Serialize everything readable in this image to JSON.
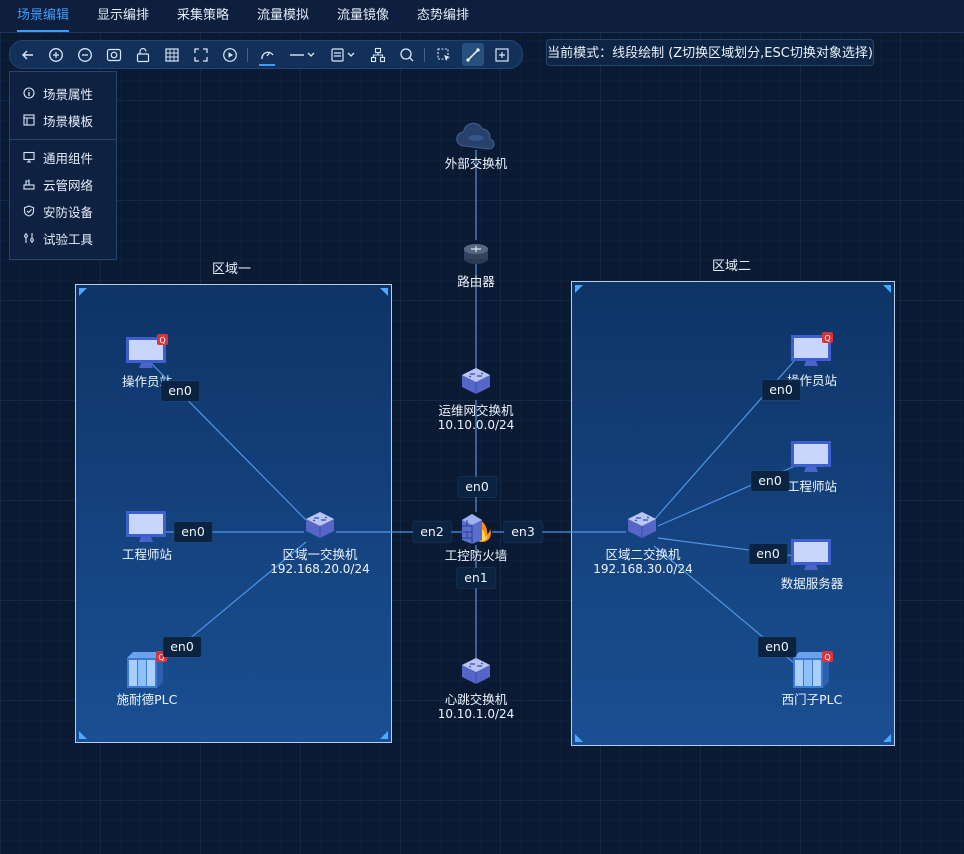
{
  "menu": {
    "items": [
      {
        "label": "场景编辑",
        "active": true
      },
      {
        "label": "显示编排",
        "active": false
      },
      {
        "label": "采集策略",
        "active": false
      },
      {
        "label": "流量模拟",
        "active": false
      },
      {
        "label": "流量镜像",
        "active": false
      },
      {
        "label": "态势编排",
        "active": false
      }
    ]
  },
  "toolbar": {
    "tools": [
      "back-icon",
      "zoom-in-icon",
      "zoom-out-icon",
      "fit-view-icon",
      "lock-icon",
      "grid-icon",
      "fullscreen-icon",
      "play-icon",
      "line-style-icon",
      "line-dash-icon",
      "layer-icon",
      "topology-icon",
      "search-icon",
      "select-region-icon",
      "line-draw-icon",
      "add-frame-icon"
    ],
    "active_tool": "line-draw-icon"
  },
  "mode": {
    "text": "当前模式：线段绘制 (Z切换区域划分,ESC切换对象选择)"
  },
  "left_panel": {
    "items": [
      {
        "label": "场景属性",
        "icon": "info-icon"
      },
      {
        "label": "场景模板",
        "icon": "template-icon"
      },
      {
        "label": "通用组件",
        "icon": "monitor-icon"
      },
      {
        "label": "云管网络",
        "icon": "network-icon"
      },
      {
        "label": "安防设备",
        "icon": "shield-icon"
      },
      {
        "label": "试验工具",
        "icon": "tools-icon"
      }
    ]
  },
  "zones": {
    "zone1": {
      "title": "区域一"
    },
    "zone2": {
      "title": "区域二"
    }
  },
  "nodes": {
    "ext_switch": {
      "label": "外部交换机",
      "icon": "cloud-icon"
    },
    "router": {
      "label": "路由器",
      "icon": "router-icon"
    },
    "ops_switch": {
      "label": "运维网交换机",
      "subnet": "10.10.0.0/24",
      "icon": "switch-icon"
    },
    "firewall": {
      "label": "工控防火墙",
      "icon": "firewall-icon"
    },
    "hb_switch": {
      "label": "心跳交换机",
      "subnet": "10.10.1.0/24",
      "icon": "switch-icon"
    },
    "z1_switch": {
      "label": "区域一交换机",
      "subnet": "192.168.20.0/24",
      "icon": "switch-icon"
    },
    "z2_switch": {
      "label": "区域二交换机",
      "subnet": "192.168.30.0/24",
      "icon": "switch-icon"
    },
    "z1_operator": {
      "label": "操作员站",
      "icon": "monitor-icon"
    },
    "z1_engineer": {
      "label": "工程师站",
      "icon": "monitor-icon"
    },
    "z1_plc": {
      "label": "施耐德PLC",
      "icon": "plc-icon"
    },
    "z2_operator": {
      "label": "操作员站",
      "icon": "monitor-icon"
    },
    "z2_engineer": {
      "label": "工程师站",
      "icon": "monitor-icon"
    },
    "z2_data": {
      "label": "数据服务器",
      "icon": "monitor-icon"
    },
    "z2_plc": {
      "label": "西门子PLC",
      "icon": "plc-icon"
    }
  },
  "ports": {
    "p1": "en0",
    "p2": "en0",
    "p3": "en0",
    "p4": "en2",
    "p5": "en3",
    "p6": "en0",
    "p7": "en1",
    "p8": "en0",
    "p9": "en0",
    "p10": "en0",
    "p11": "en0"
  },
  "colors": {
    "accent": "#3d9bff",
    "link": "#4f95e6",
    "zone_border": "#b9cde6",
    "background": "#0b1a33"
  }
}
